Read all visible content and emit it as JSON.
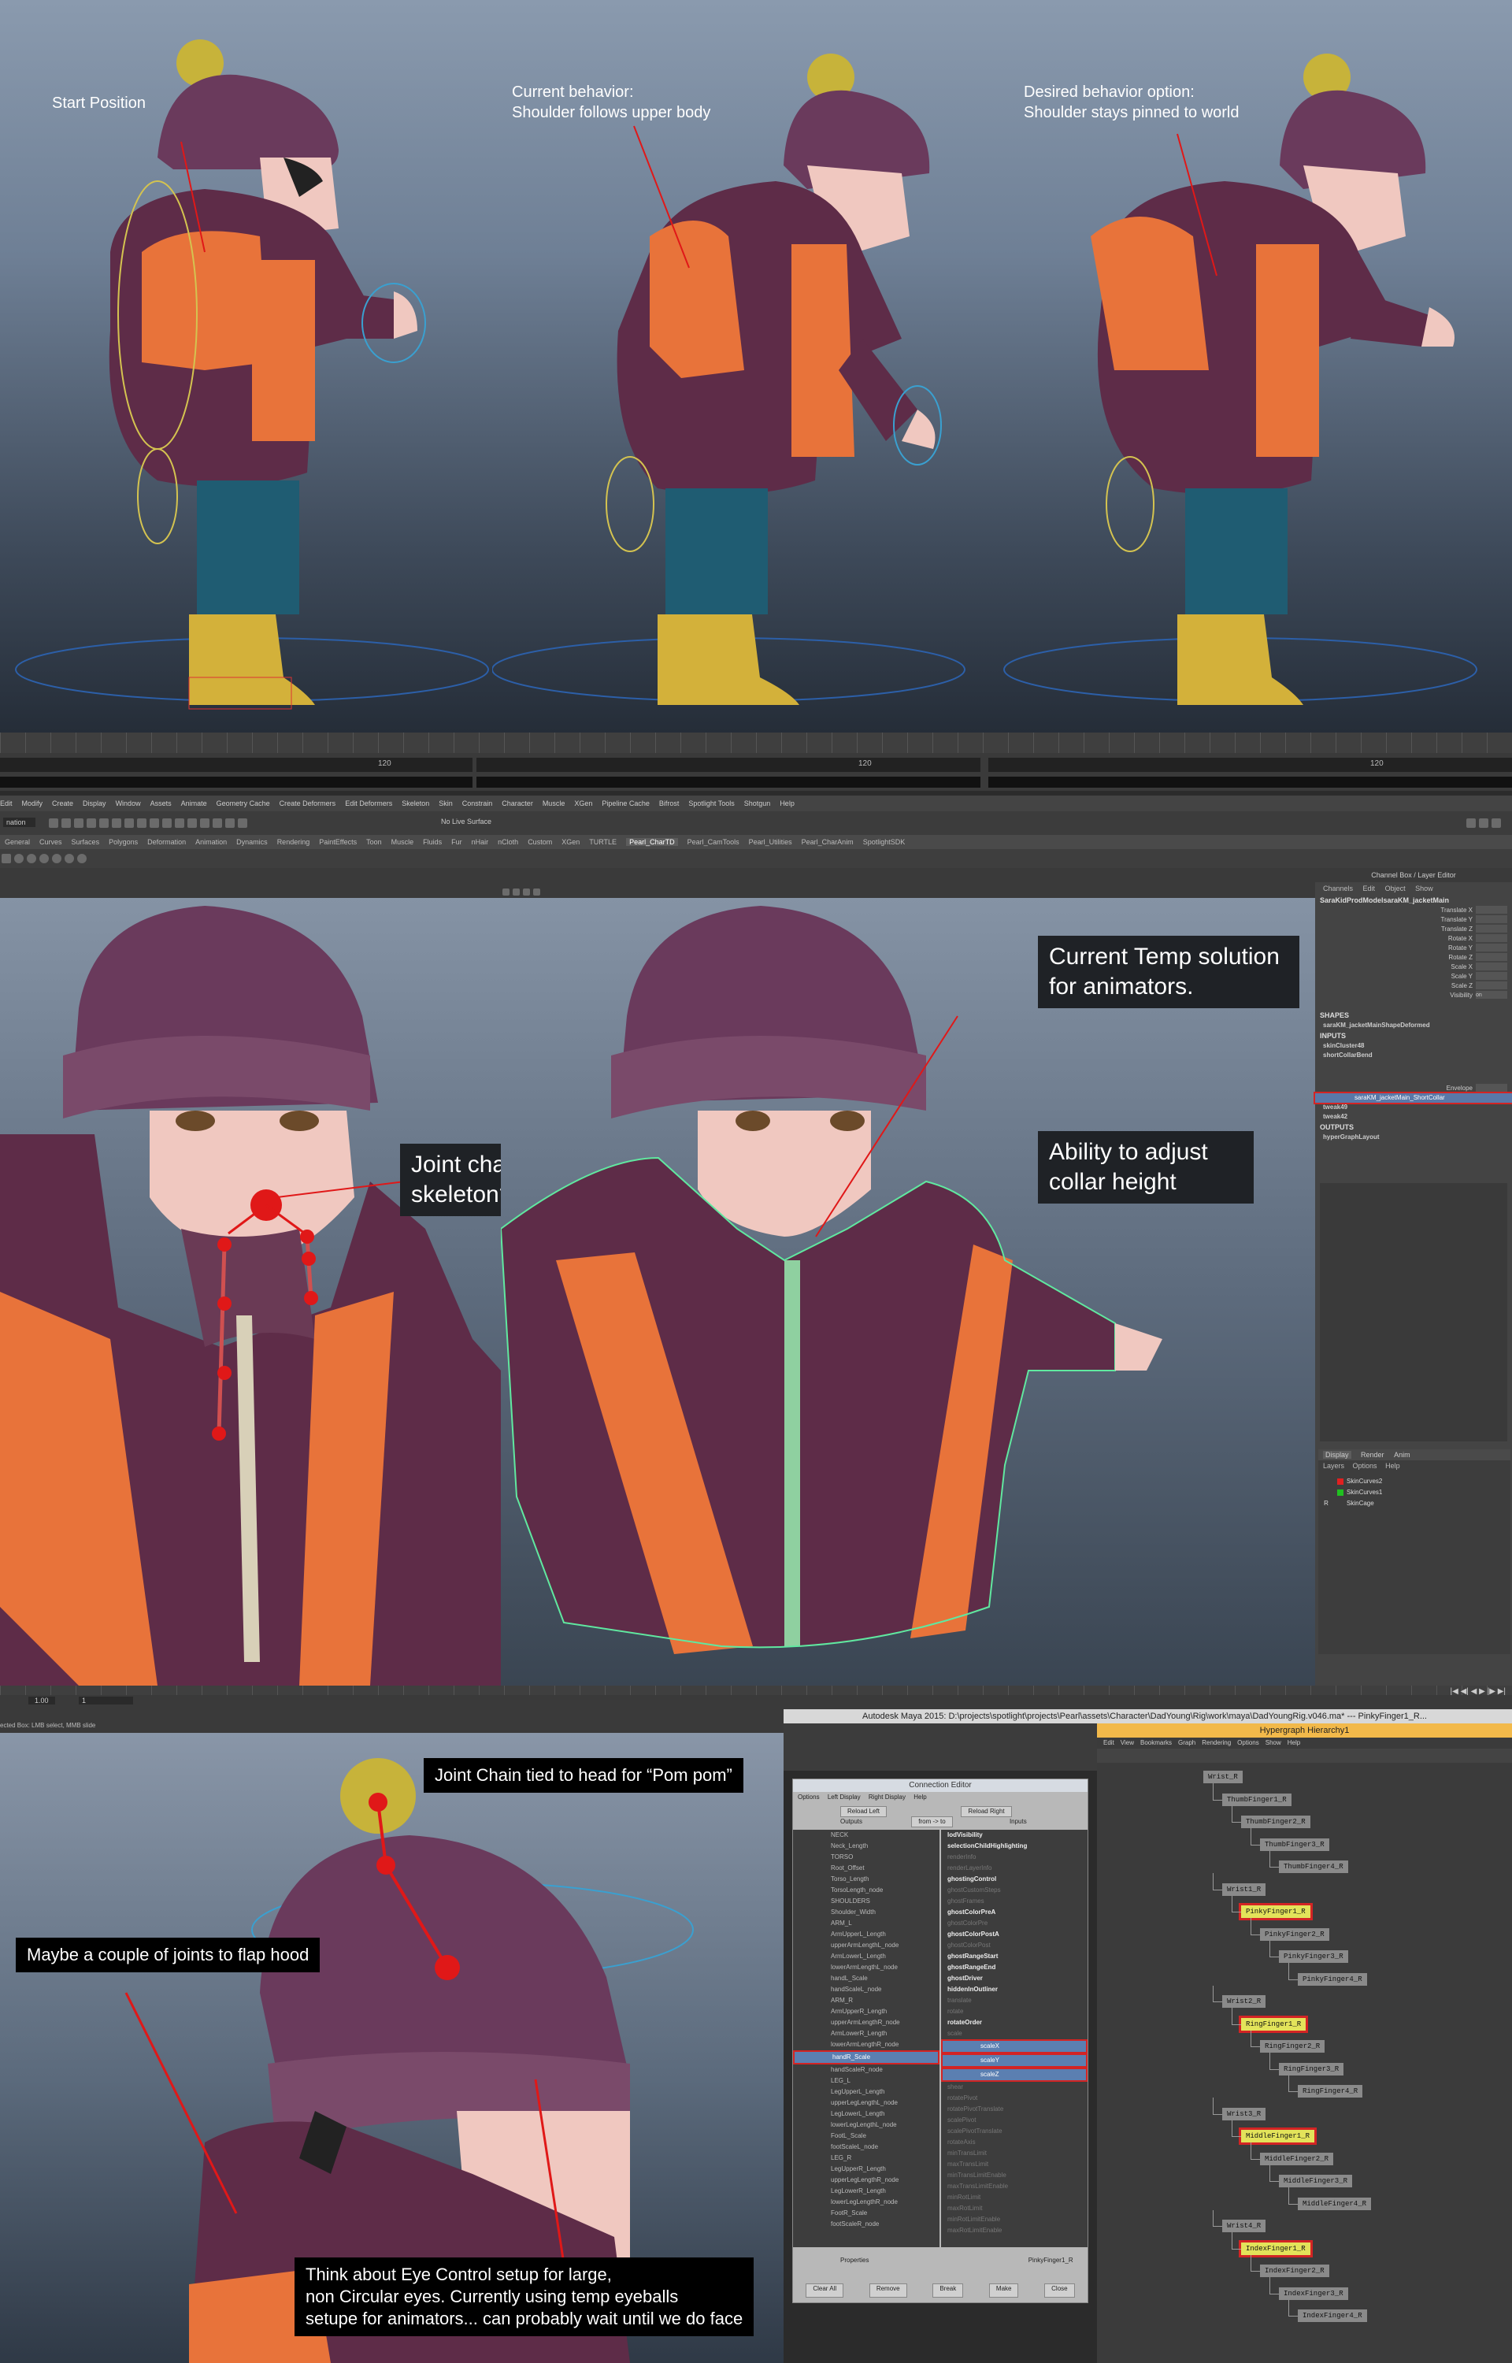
{
  "section1": {
    "labels": [
      "Start Position",
      "Current behavior:\nShoulder follows upper body",
      "Desired behavior option:\nShoulder stays pinned to world"
    ],
    "frame_labels": [
      "120",
      "120",
      "120"
    ]
  },
  "maya": {
    "menus": [
      "Edit",
      "Modify",
      "Create",
      "Display",
      "Window",
      "Assets",
      "Animate",
      "Geometry Cache",
      "Create Deformers",
      "Edit Deformers",
      "Skeleton",
      "Skin",
      "Constrain",
      "Character",
      "Muscle",
      "XGen",
      "Pipeline Cache",
      "Bifrost",
      "Spotlight Tools",
      "Shotgun",
      "Help"
    ],
    "mode": "nation",
    "toolbar_text": "No Live Surface",
    "shelf_tabs": [
      "General",
      "Curves",
      "Surfaces",
      "Polygons",
      "Deformation",
      "Animation",
      "Dynamics",
      "Rendering",
      "PaintEffects",
      "Toon",
      "Muscle",
      "Fluids",
      "Fur",
      "nHair",
      "nCloth",
      "Custom",
      "XGen",
      "TURTLE",
      "Pearl_CharTD",
      "Pearl_CamTools",
      "Pearl_Utilities",
      "Pearl_CharAnim",
      "SpotlightSDK"
    ],
    "active_shelf": "Pearl_CharTD"
  },
  "section2": {
    "callouts": [
      "Current Temp solution\nfor animators.",
      "Joint chains tied into\nskeleton?",
      "Ability to adjust\ncollar height"
    ]
  },
  "channel_box": {
    "header": "Channel Box / Layer Editor",
    "menu": [
      "Channels",
      "Edit",
      "Object",
      "Show"
    ],
    "node": "SaraKidProdModelsaraKM_jacketMain",
    "attrs": [
      "Translate X",
      "Translate Y",
      "Translate Z",
      "Rotate X",
      "Rotate Y",
      "Rotate Z",
      "Scale X",
      "Scale Y",
      "Scale Z",
      "Visibility"
    ],
    "visibility_value": "on",
    "shapes_label": "SHAPES",
    "shape_node": "saraKM_jacketMainShapeDeformed",
    "inputs_label": "INPUTS",
    "inputs": [
      "skinCluster48",
      "shortCollarBend"
    ],
    "envelope_label": "Envelope",
    "highlighted": "saraKM_jacketMain_ShortCollar",
    "more_inputs": [
      "tweak49",
      "tweak42"
    ],
    "outputs_label": "OUTPUTS",
    "outputs": [
      "hyperGraphLayout"
    ],
    "layer_tabs": [
      "Display",
      "Render",
      "Anim"
    ],
    "layer_menu": [
      "Layers",
      "Options",
      "Help"
    ],
    "layers": [
      {
        "name": "SkinCurves2",
        "color": "#e02020"
      },
      {
        "name": "SkinCurves1",
        "color": "#20c020"
      },
      {
        "name": "SkinCage",
        "color": ""
      }
    ],
    "layer_r": "R"
  },
  "timeline2": {
    "start": "1.00",
    "current": "1"
  },
  "section3": {
    "notes": [
      "Joint Chain tied to head for “Pom pom”",
      "Maybe a couple of joints to flap hood",
      "Think about Eye Control setup for large,\nnon Circular eyes. Currently using temp eyeballs\nsetupe for animators... can probably wait until we do face"
    ],
    "status": "ected Box: LMB select, MMB slide"
  },
  "window_title": "Autodesk Maya 2015: D:\\projects\\spotlight\\projects\\Pearl\\assets\\Character\\DadYoung\\Rig\\work\\maya\\DadYoungRig.v046.ma*  ---  PinkyFinger1_R...",
  "connection_editor": {
    "title": "Connection Editor",
    "menu": [
      "Options",
      "Left Display",
      "Right Display",
      "Help"
    ],
    "reload_left": "Reload Left",
    "reload_right": "Reload Right",
    "outputs": "Outputs",
    "from_to": "from -> to",
    "inputs": "Inputs",
    "left_items": [
      "NECK",
      "Neck_Length",
      "TORSO",
      "Root_Offset",
      "Torso_Length",
      "TorsoLength_node",
      "SHOULDERS",
      "Shoulder_Width",
      "ARM_L",
      "ArmUpperL_Length",
      "upperArmLengthL_node",
      "ArmLowerL_Length",
      "lowerArmLengthL_node",
      "handL_Scale",
      "handScaleL_node",
      "ARM_R",
      "ArmUpperR_Length",
      "upperArmLengthR_node",
      "ArmLowerR_Length",
      "lowerArmLengthR_node",
      "handR_Scale",
      "handScaleR_node",
      "LEG_L",
      "LegUpperL_Length",
      "upperLegLengthL_node",
      "LegLowerL_Length",
      "lowerLegLengthL_node",
      "FootL_Scale",
      "footScaleL_node",
      "LEG_R",
      "LegUpperR_Length",
      "upperLegLengthR_node",
      "LegLowerR_Length",
      "lowerLegLengthR_node",
      "FootR_Scale",
      "footScaleR_node"
    ],
    "left_selected": "handR_Scale",
    "right_items": [
      {
        "t": "lodVisibility",
        "s": "b"
      },
      {
        "t": "selectionChildHighlighting",
        "s": "b"
      },
      {
        "t": "renderInfo",
        "s": "dim"
      },
      {
        "t": "renderLayerInfo",
        "s": "dim"
      },
      {
        "t": "ghostingControl",
        "s": "b"
      },
      {
        "t": "ghostCustomSteps",
        "s": "dim"
      },
      {
        "t": "ghostFrames",
        "s": "dim"
      },
      {
        "t": "ghostColorPreA",
        "s": "b"
      },
      {
        "t": "ghostColorPre",
        "s": "dim"
      },
      {
        "t": "ghostColorPostA",
        "s": "b"
      },
      {
        "t": "ghostColorPost",
        "s": "dim"
      },
      {
        "t": "ghostRangeStart",
        "s": "b"
      },
      {
        "t": "ghostRangeEnd",
        "s": "b"
      },
      {
        "t": "ghostDriver",
        "s": "b"
      },
      {
        "t": "hiddenInOutliner",
        "s": "b"
      },
      {
        "t": "translate",
        "s": "dim"
      },
      {
        "t": "rotate",
        "s": "dim"
      },
      {
        "t": "rotateOrder",
        "s": "b"
      },
      {
        "t": "scale",
        "s": "dim"
      },
      {
        "t": "scaleX",
        "s": "hl"
      },
      {
        "t": "scaleY",
        "s": "hl"
      },
      {
        "t": "scaleZ",
        "s": "hl"
      },
      {
        "t": "shear",
        "s": "dim"
      },
      {
        "t": "rotatePivot",
        "s": "dim"
      },
      {
        "t": "rotatePivotTranslate",
        "s": "dim"
      },
      {
        "t": "scalePivot",
        "s": "dim"
      },
      {
        "t": "scalePivotTranslate",
        "s": "dim"
      },
      {
        "t": "rotateAxis",
        "s": "dim"
      },
      {
        "t": "minTransLimit",
        "s": "dim"
      },
      {
        "t": "maxTransLimit",
        "s": "dim"
      },
      {
        "t": "minTransLimitEnable",
        "s": "dim"
      },
      {
        "t": "maxTransLimitEnable",
        "s": "dim"
      },
      {
        "t": "minRotLimit",
        "s": "dim"
      },
      {
        "t": "maxRotLimit",
        "s": "dim"
      },
      {
        "t": "minRotLimitEnable",
        "s": "dim"
      },
      {
        "t": "maxRotLimitEnable",
        "s": "dim"
      }
    ],
    "properties": "Properties",
    "right_node": "PinkyFinger1_R",
    "buttons": [
      "Clear All",
      "Remove",
      "Break",
      "Make",
      "Close"
    ]
  },
  "hypergraph": {
    "title": "Hypergraph Hierarchy1",
    "menu": [
      "Edit",
      "View",
      "Bookmarks",
      "Graph",
      "Rendering",
      "Options",
      "Show",
      "Help"
    ],
    "nodes": [
      {
        "label": "Wrist_R",
        "sel": false
      },
      {
        "label": "ThumbFinger1_R",
        "sel": false
      },
      {
        "label": "ThumbFinger2_R",
        "sel": false
      },
      {
        "label": "ThumbFinger3_R",
        "sel": false
      },
      {
        "label": "ThumbFinger4_R",
        "sel": false
      },
      {
        "label": "Wrist1_R",
        "sel": false
      },
      {
        "label": "PinkyFinger1_R",
        "sel": true
      },
      {
        "label": "PinkyFinger2_R",
        "sel": false
      },
      {
        "label": "PinkyFinger3_R",
        "sel": false
      },
      {
        "label": "PinkyFinger4_R",
        "sel": false
      },
      {
        "label": "Wrist2_R",
        "sel": false
      },
      {
        "label": "RingFinger1_R",
        "sel": true
      },
      {
        "label": "RingFinger2_R",
        "sel": false
      },
      {
        "label": "RingFinger3_R",
        "sel": false
      },
      {
        "label": "RingFinger4_R",
        "sel": false
      },
      {
        "label": "Wrist3_R",
        "sel": false
      },
      {
        "label": "MiddleFinger1_R",
        "sel": true
      },
      {
        "label": "MiddleFinger2_R",
        "sel": false
      },
      {
        "label": "MiddleFinger3_R",
        "sel": false
      },
      {
        "label": "MiddleFinger4_R",
        "sel": false
      },
      {
        "label": "Wrist4_R",
        "sel": false
      },
      {
        "label": "IndexFinger1_R",
        "sel": true
      },
      {
        "label": "IndexFinger2_R",
        "sel": false
      },
      {
        "label": "IndexFinger3_R",
        "sel": false
      },
      {
        "label": "IndexFinger4_R",
        "sel": false
      }
    ]
  },
  "colors": {
    "hat": "#6a3a5c",
    "jacket": "#5e2c48",
    "orange": "#e8733a",
    "pants": "#1f5c72",
    "boots": "#d3b13a",
    "pompom": "#c7b33a",
    "annotation_red": "#e01818",
    "callout_bg": "#1f2226"
  }
}
